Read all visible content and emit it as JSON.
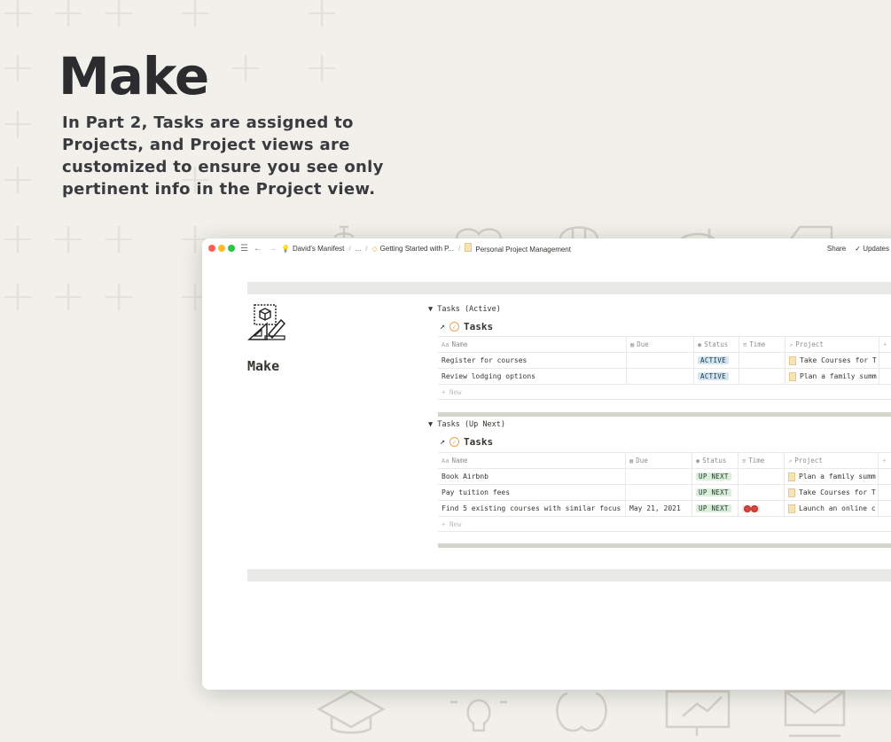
{
  "hero": {
    "title": "Make",
    "subtitle": "In Part 2, Tasks are assigned to Projects, and Project views are customized to ensure you see only pertinent info in the Project view."
  },
  "window": {
    "breadcrumbs": [
      {
        "label": "David's Manifest",
        "icon": "lightbulb-icon"
      },
      {
        "label": "..."
      },
      {
        "label": "Getting Started with P...",
        "icon": "gem-icon"
      },
      {
        "label": "Personal Project Management",
        "icon": "page-icon"
      }
    ],
    "share_label": "Share",
    "updates_label": "✓ Updates"
  },
  "page": {
    "title": "Make",
    "icon": "drafting-tools-icon"
  },
  "columns": {
    "name": "Name",
    "due": "Due",
    "status": "Status",
    "time": "Time",
    "project": "Project",
    "add": "+"
  },
  "active_section": {
    "toggle_label": "▼ Tasks (Active)",
    "db_title": "Tasks",
    "rows": [
      {
        "name": "Register for courses",
        "due": "",
        "status": "ACTIVE",
        "time": "",
        "project": "Take Courses for T"
      },
      {
        "name": "Review lodging options",
        "due": "",
        "status": "ACTIVE",
        "time": "",
        "project": "Plan a family summ"
      }
    ],
    "new_label": "+ New"
  },
  "upnext_section": {
    "toggle_label": "▼ Tasks (Up Next)",
    "db_title": "Tasks",
    "rows": [
      {
        "name": "Book Airbnb",
        "due": "",
        "status": "UP NEXT",
        "time": "",
        "project": "Plan a family summ"
      },
      {
        "name": "Pay tuition fees",
        "due": "",
        "status": "UP NEXT",
        "time": "",
        "project": "Take Courses for T"
      },
      {
        "name": "Find 5 existing courses with similar focus",
        "due": "May 21, 2021",
        "status": "UP NEXT",
        "time": "tomatoes",
        "project": "Launch an online c"
      }
    ],
    "new_label": "+ New"
  },
  "colors": {
    "background": "#f1f0ea",
    "active_badge": "#d3e5ef",
    "upnext_badge": "#dbeddb"
  }
}
